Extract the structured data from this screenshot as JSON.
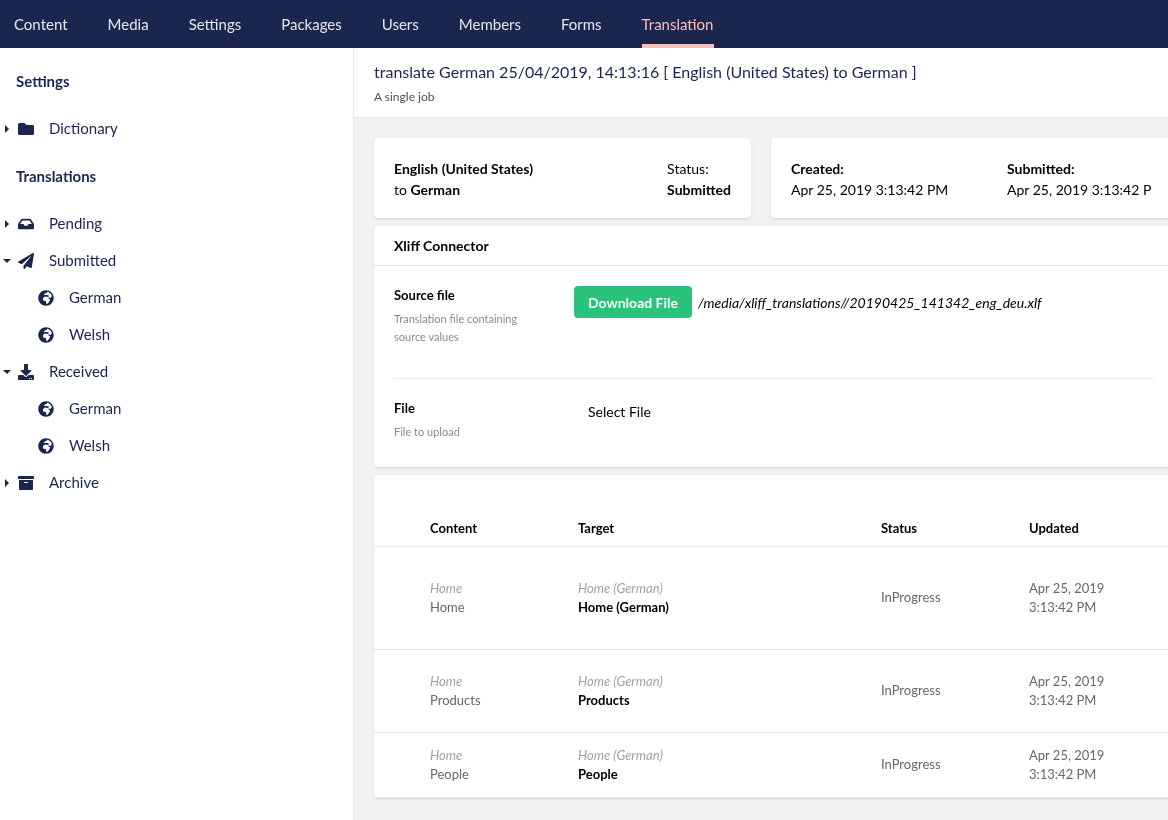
{
  "nav": [
    {
      "label": "Content",
      "selected": false
    },
    {
      "label": "Media",
      "selected": false
    },
    {
      "label": "Settings",
      "selected": false
    },
    {
      "label": "Packages",
      "selected": false
    },
    {
      "label": "Users",
      "selected": false
    },
    {
      "label": "Members",
      "selected": false
    },
    {
      "label": "Forms",
      "selected": false
    },
    {
      "label": "Translation",
      "selected": true
    }
  ],
  "sidebar": {
    "sections": [
      {
        "title": "Settings",
        "items": [
          {
            "label": "Dictionary",
            "kind": "folder",
            "expanded": false
          }
        ]
      },
      {
        "title": "Translations",
        "items": [
          {
            "label": "Pending",
            "kind": "inbox",
            "expanded": false
          },
          {
            "label": "Submitted",
            "kind": "send",
            "expanded": true,
            "children": [
              {
                "label": "German",
                "kind": "globe"
              },
              {
                "label": "Welsh",
                "kind": "globe"
              }
            ]
          },
          {
            "label": "Received",
            "kind": "download",
            "expanded": true,
            "children": [
              {
                "label": "German",
                "kind": "globe"
              },
              {
                "label": "Welsh",
                "kind": "globe"
              }
            ]
          },
          {
            "label": "Archive",
            "kind": "archive",
            "expanded": false
          }
        ]
      }
    ]
  },
  "header": {
    "title": "translate German 25/04/2019, 14:13:16 [ English (United States) to German ]",
    "subtitle": "A single job"
  },
  "summary": {
    "source": "English (United States)",
    "to": "to",
    "target": "German",
    "status_label": "Status:",
    "status": "Submitted",
    "created_label": "Created:",
    "created": "Apr 25, 2019 3:13:42 PM",
    "submitted_label": "Submitted:",
    "submitted": "Apr 25, 2019 3:13:42 P"
  },
  "connector": {
    "title": "Xliff Connector",
    "fields": [
      {
        "kind": "download",
        "label": "Source file",
        "description": "Translation file containing source values",
        "button": "Download File",
        "path": "/media/xliff_translations//20190425_141342_eng_deu.xlf"
      },
      {
        "kind": "upload",
        "label": "File",
        "description": "File to upload",
        "button": "Select File"
      }
    ]
  },
  "table": {
    "columns": [
      "Content",
      "Target",
      "Status",
      "Updated"
    ],
    "rows": [
      {
        "content_parent": "Home",
        "content": "Home",
        "target_parent": "Home (German)",
        "target": "Home (German)",
        "status": "InProgress",
        "updated_date": "Apr 25, 2019",
        "updated_time": "3:13:42 PM"
      },
      {
        "content_parent": "Home",
        "content": "Products",
        "target_parent": "Home (German)",
        "target": "Products",
        "status": "InProgress",
        "updated_date": "Apr 25, 2019",
        "updated_time": "3:13:42 PM"
      },
      {
        "content_parent": "Home",
        "content": "People",
        "target_parent": "Home (German)",
        "target": "People",
        "status": "InProgress",
        "updated_date": "Apr 25, 2019",
        "updated_time": "3:13:42 PM"
      }
    ]
  }
}
